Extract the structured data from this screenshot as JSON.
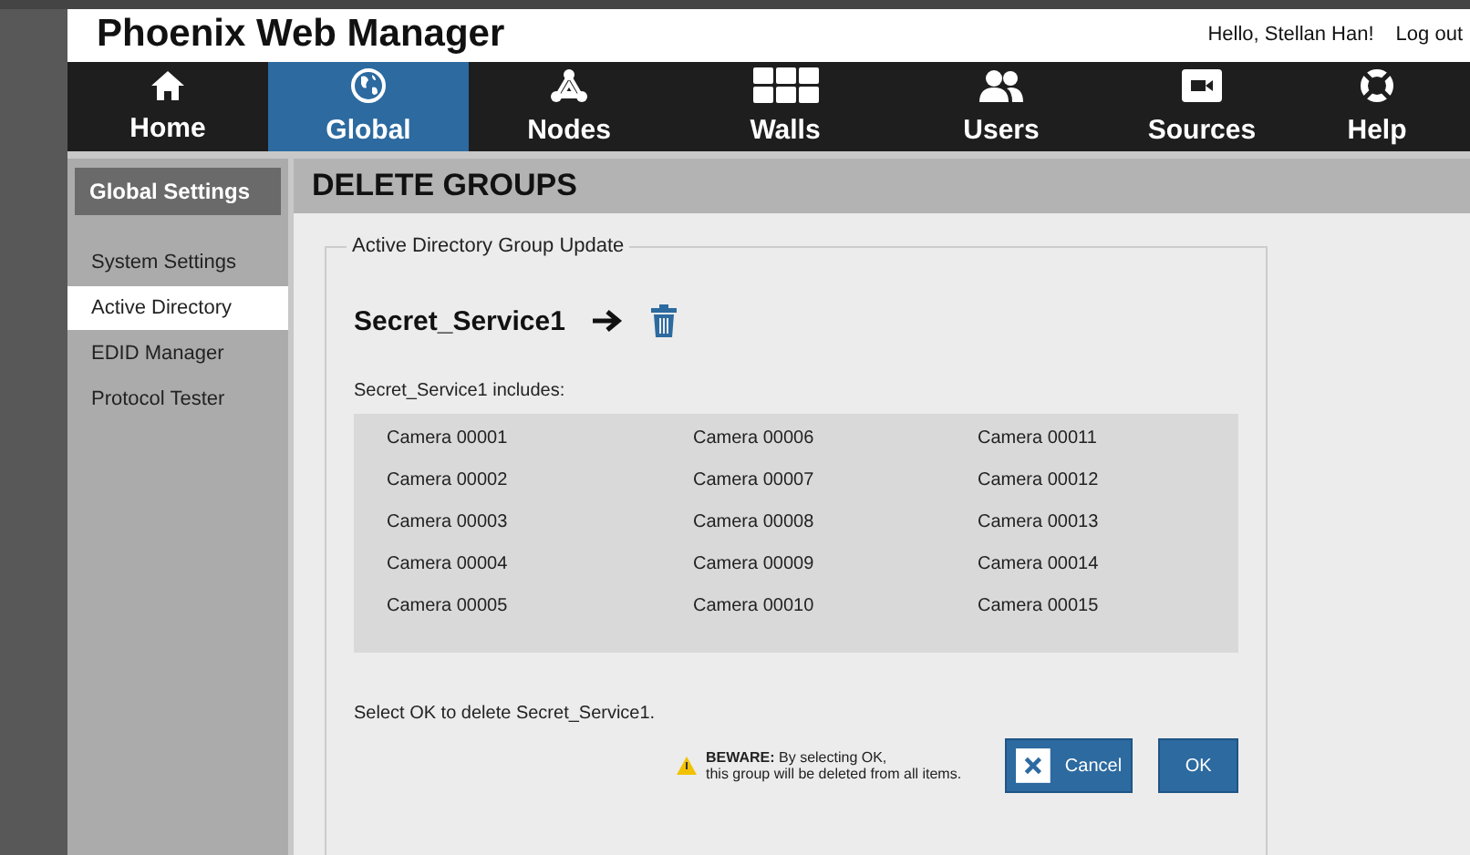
{
  "header": {
    "title": "Phoenix Web Manager",
    "greeting": "Hello, Stellan Han!",
    "logout": "Log out"
  },
  "nav": [
    {
      "label": "Home",
      "kind": "home",
      "selected": false
    },
    {
      "label": "Global",
      "kind": "global",
      "selected": true
    },
    {
      "label": "Nodes",
      "kind": "nodes",
      "selected": false
    },
    {
      "label": "Walls",
      "kind": "walls",
      "selected": false
    },
    {
      "label": "Users",
      "kind": "users",
      "selected": false
    },
    {
      "label": "Sources",
      "kind": "sources",
      "selected": false
    },
    {
      "label": "Help",
      "kind": "help",
      "selected": false
    }
  ],
  "sidebar": {
    "title": "Global Settings",
    "items": [
      {
        "label": "System Settings",
        "selected": false
      },
      {
        "label": "Active Directory",
        "selected": true
      },
      {
        "label": "EDID Manager",
        "selected": false
      },
      {
        "label": "Protocol Tester",
        "selected": false
      }
    ]
  },
  "page_title": "DELETE GROUPS",
  "panel": {
    "legend": "Active Directory Group Update",
    "group": "Secret_Service1",
    "includes_label": "Secret_Service1 includes:",
    "members": [
      "Camera 00001",
      "Camera 00002",
      "Camera 00003",
      "Camera 00004",
      "Camera 00005",
      "Camera 00006",
      "Camera 00007",
      "Camera 00008",
      "Camera 00009",
      "Camera 00010",
      "Camera 00011",
      "Camera 00012",
      "Camera 00013",
      "Camera 00014",
      "Camera 00015"
    ],
    "prompt": "Select OK to delete Secret_Service1.",
    "warning": "**BEWARE:** By selecting OK,\nthis group will be deleted from all items.",
    "buttons": [
      {
        "label": "Cancel",
        "kind": "cancel"
      },
      {
        "label": "OK",
        "kind": "ok"
      }
    ]
  }
}
